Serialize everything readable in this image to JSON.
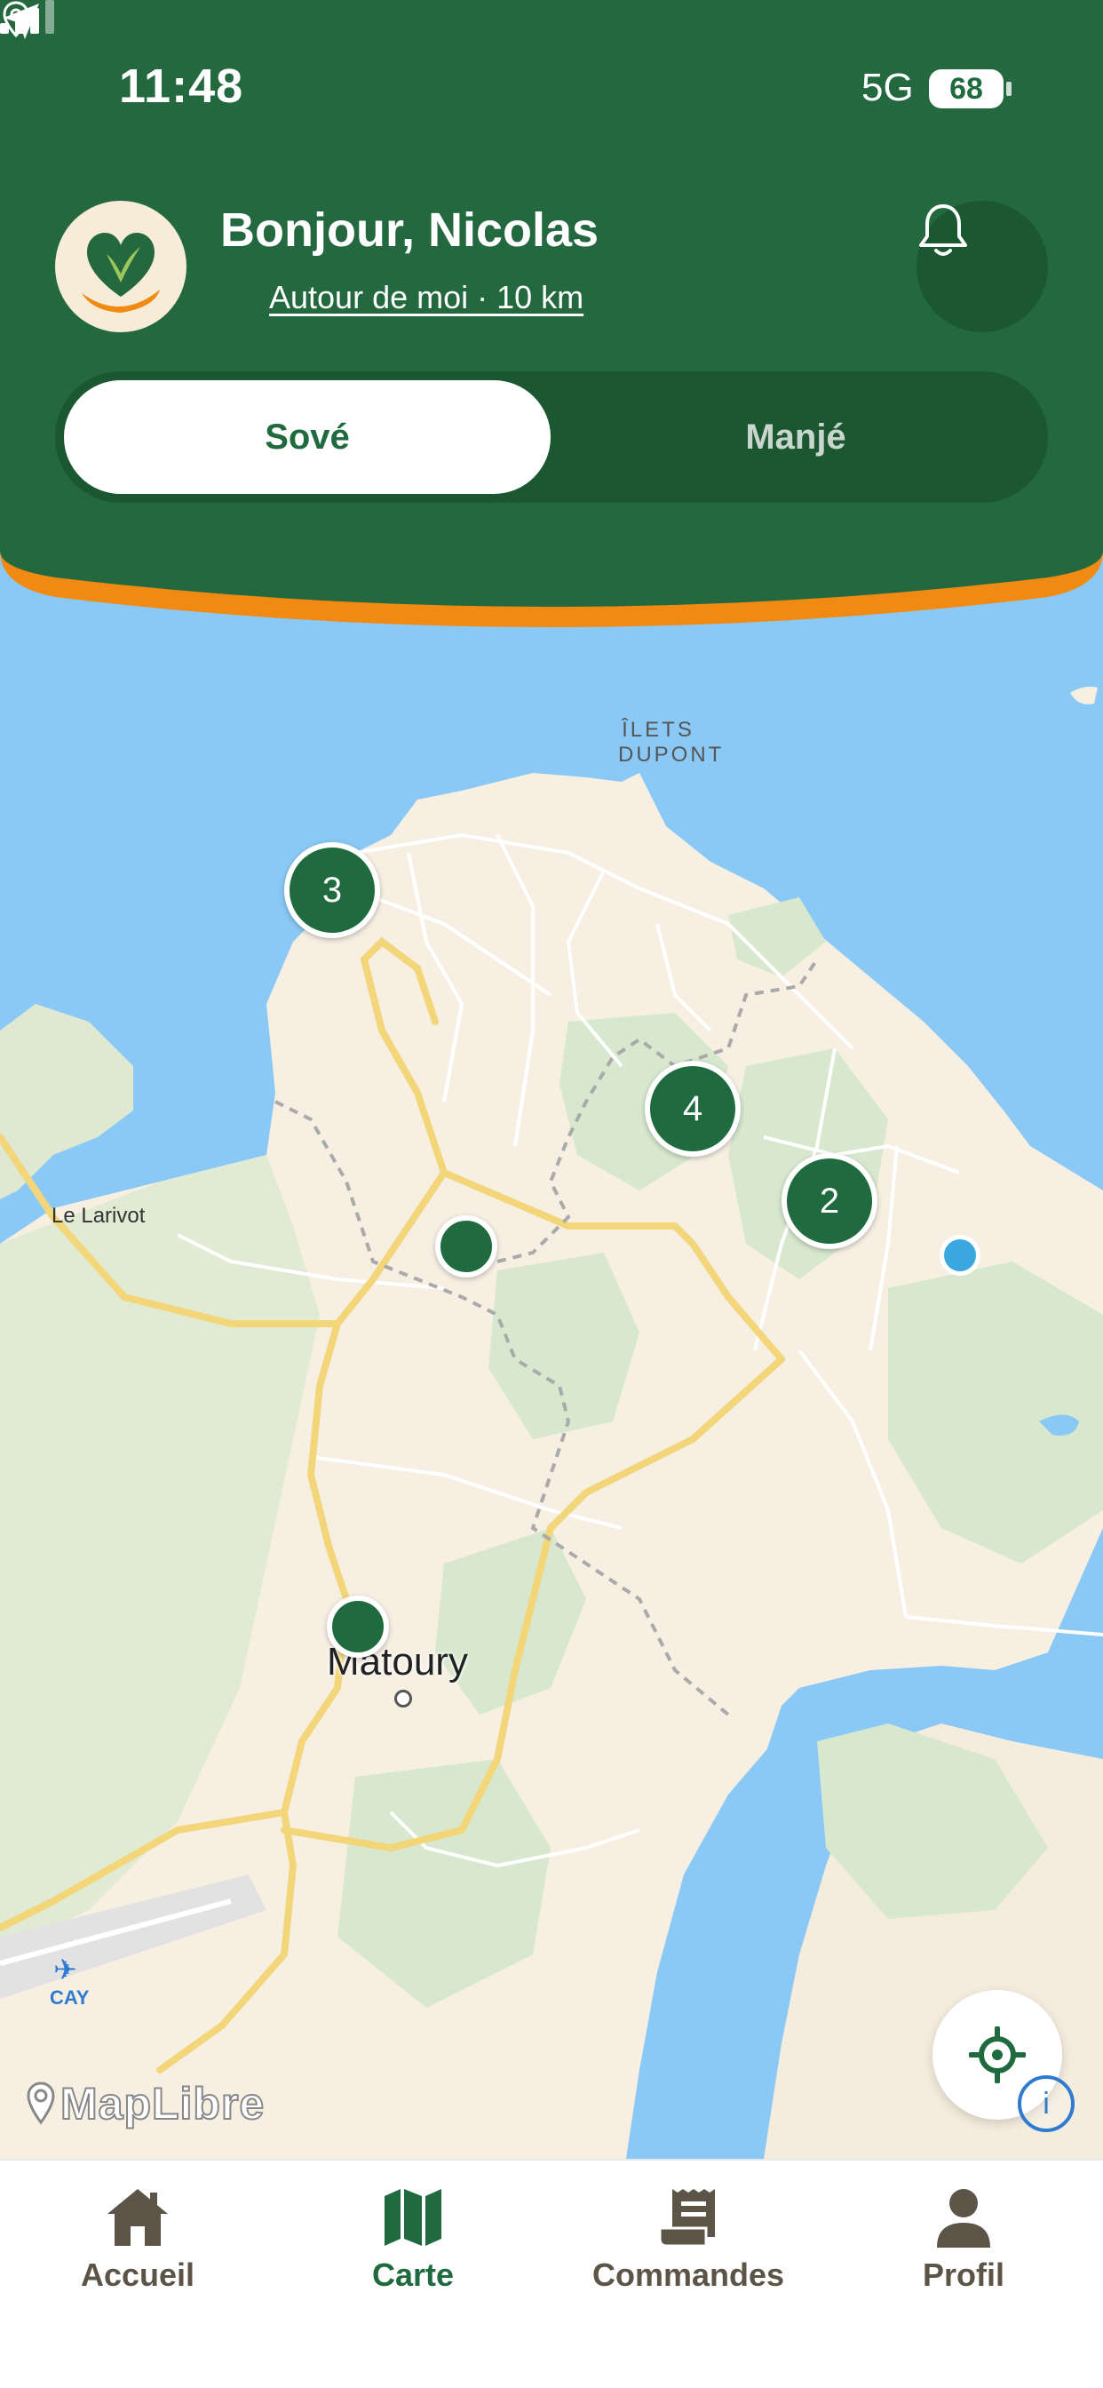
{
  "status_bar": {
    "time": "11:48",
    "network": "5G",
    "battery": "68"
  },
  "header": {
    "greeting": "Bonjour, Nicolas",
    "location_filter": "Autour de moi · 10 km",
    "tabs": [
      {
        "label": "Sové",
        "active": true
      },
      {
        "label": "Manjé",
        "active": false
      }
    ]
  },
  "map": {
    "labels": {
      "ilets": "ÎLETS DUPONT",
      "larivot": "Le Larivot",
      "matoury": "Matoury",
      "cay": "CAY"
    },
    "clusters": [
      {
        "count": "3"
      },
      {
        "count": "4"
      },
      {
        "count": "2"
      }
    ],
    "attribution": "MapLibre",
    "info_badge": "i"
  },
  "bottom_nav": {
    "items": [
      {
        "label": "Accueil",
        "icon": "home-icon",
        "active": false
      },
      {
        "label": "Carte",
        "icon": "map-icon",
        "active": true
      },
      {
        "label": "Commandes",
        "icon": "receipt-icon",
        "active": false
      },
      {
        "label": "Profil",
        "icon": "profile-icon",
        "active": false
      }
    ]
  },
  "colors": {
    "brand_green": "#23683f",
    "dark_green": "#1b5730",
    "accent_orange": "#f08a12",
    "water": "#8ac9f5",
    "land": "#f6efe2",
    "vegetation": "#d9ead0"
  }
}
